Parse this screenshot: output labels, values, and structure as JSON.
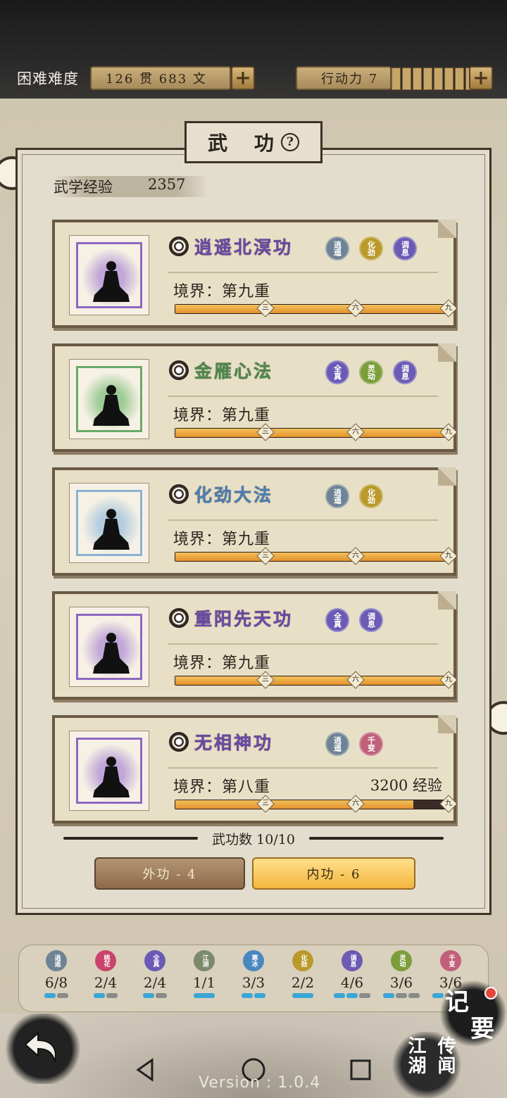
{
  "header": {
    "difficulty": "困难难度",
    "money": "126 贯  683 文",
    "action_power": "行动力 7",
    "action_segments": 8
  },
  "panel": {
    "title": "武 功",
    "exp_label": "武学经验",
    "exp_value": "2357"
  },
  "skills": [
    {
      "name": "逍遥北溟功",
      "name_color": "#6b49a6",
      "halo": "#b79ad6",
      "border": "#8f68c2",
      "realm": "境界：第九重",
      "exp": "",
      "progress": 1.0,
      "badges": [
        {
          "text": "逍遥",
          "color": "#6e8394"
        },
        {
          "text": "化劲",
          "color": "#b99a2a"
        },
        {
          "text": "调息",
          "color": "#6b5bb3"
        }
      ]
    },
    {
      "name": "金雁心法",
      "name_color": "#4f8a4a",
      "halo": "#8fc58a",
      "border": "#6aa968",
      "realm": "境界：第九重",
      "exp": "",
      "progress": 1.0,
      "badges": [
        {
          "text": "全真",
          "color": "#6a5ab5"
        },
        {
          "text": "灵动",
          "color": "#7b9e3a"
        },
        {
          "text": "调息",
          "color": "#6b5bb3"
        }
      ]
    },
    {
      "name": "化劲大法",
      "name_color": "#4b7fb3",
      "halo": "#a7c6de",
      "border": "#8ab1d3",
      "realm": "境界：第九重",
      "exp": "",
      "progress": 1.0,
      "badges": [
        {
          "text": "逍遥",
          "color": "#6e8394"
        },
        {
          "text": "化劲",
          "color": "#b99a2a"
        }
      ]
    },
    {
      "name": "重阳先天功",
      "name_color": "#6b49a6",
      "halo": "#b79ad6",
      "border": "#8f68c2",
      "realm": "境界：第九重",
      "exp": "",
      "progress": 1.0,
      "badges": [
        {
          "text": "全真",
          "color": "#6a5ab5"
        },
        {
          "text": "调息",
          "color": "#6b5bb3"
        }
      ]
    },
    {
      "name": "无相神功",
      "name_color": "#6b49a6",
      "halo": "#b79ad6",
      "border": "#8f68c2",
      "realm": "境界：第八重",
      "exp": "3200 经验",
      "progress": 0.87,
      "badges": [
        {
          "text": "逍遥",
          "color": "#6e8394"
        },
        {
          "text": "千变",
          "color": "#c0607a"
        }
      ]
    }
  ],
  "ticks": [
    "三",
    "六",
    "九"
  ],
  "skill_count": "武功数 10/10",
  "tabs": {
    "outer": "外功 - 4",
    "inner": "内功 - 6"
  },
  "schools": [
    {
      "badge": "逍遥",
      "color": "#6e8394",
      "value": "6/8",
      "on": 1,
      "total": 2
    },
    {
      "badge": "桃花",
      "color": "#c8436d",
      "value": "2/4",
      "on": 1,
      "total": 2
    },
    {
      "badge": "全真",
      "color": "#6a5ab5",
      "value": "2/4",
      "on": 1,
      "total": 2
    },
    {
      "badge": "江湖",
      "color": "#7a8a6a",
      "value": "1/1",
      "on": 1,
      "total": 1
    },
    {
      "badge": "寒冰",
      "color": "#4a86c0",
      "value": "3/3",
      "on": 2,
      "total": 2
    },
    {
      "badge": "化劲",
      "color": "#b99a2a",
      "value": "2/2",
      "on": 1,
      "total": 1
    },
    {
      "badge": "调息",
      "color": "#6b5bb3",
      "value": "4/6",
      "on": 2,
      "total": 3
    },
    {
      "badge": "灵动",
      "color": "#7b9e3a",
      "value": "3/6",
      "on": 1,
      "total": 3
    },
    {
      "badge": "千变",
      "color": "#c0607a",
      "value": "3/6",
      "on": 1,
      "total": 3
    }
  ],
  "shortcuts": {
    "notes_1": "记",
    "notes_2": "要",
    "legend_1": "江湖",
    "legend_2": "传闻"
  },
  "version": "Version : 1.0.4"
}
